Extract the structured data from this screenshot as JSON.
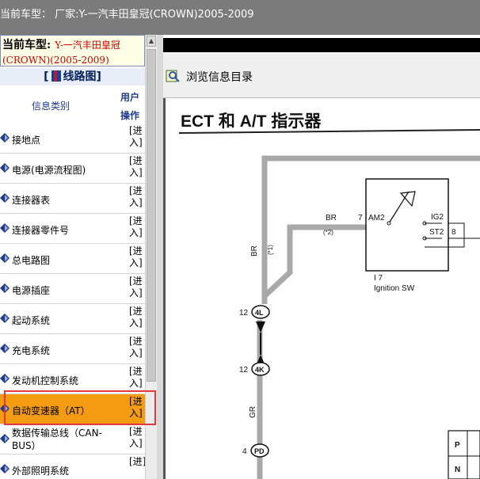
{
  "titlebar": {
    "text": "当前车型：  厂家:Y-一汽丰田皇冠(CROWN)2005-2009"
  },
  "left": {
    "model_label": "当前车型:",
    "model_value": "Y-一汽丰田皇冠(CROWN)(2005-2009)",
    "wiring_title_left": "[",
    "wiring_title": "线路图",
    "wiring_title_right": "]",
    "header": {
      "category": "信息类别",
      "ops_line1": "用户",
      "ops_line2": "操作"
    },
    "items": [
      {
        "label": "接地点",
        "enter": "[进入]"
      },
      {
        "label": "电源(电源流程图)",
        "enter": "[进入]"
      },
      {
        "label": "连接器表",
        "enter": "[进入]"
      },
      {
        "label": "连接器零件号",
        "enter": "[进入]"
      },
      {
        "label": "总电路图",
        "enter": "[进入]"
      },
      {
        "label": "电源插座",
        "enter": "[进入]"
      },
      {
        "label": "起动系统",
        "enter": "[进入]"
      },
      {
        "label": "充电系统",
        "enter": "[进入]"
      },
      {
        "label": "发动机控制系统",
        "enter": "[进入]"
      },
      {
        "label": "自动变速器（AT）",
        "enter": "[进入]"
      },
      {
        "label": "数据传输总线（CAN-BUS）",
        "enter": "[进入]"
      },
      {
        "label": "外部照明系统",
        "enter": "[进]"
      }
    ],
    "selected_index": 9
  },
  "right": {
    "toolbar_label": "浏览信息目录",
    "diagram": {
      "title": "ECT 和 A/T 指示器",
      "wire_br": "BR",
      "wire_br_sub": "(*2)",
      "wire_br_v": "BR",
      "wire_br_v_sub": "(*1)",
      "pin_7": "7",
      "am2": "AM2",
      "ig2": "IG2",
      "st2": "ST2",
      "pin_8": "8",
      "part_id": "I 7",
      "part_name": "Ignition SW",
      "conn_4l_num": "12",
      "conn_4l": "4L",
      "conn_4k_num": "12",
      "conn_4k": "4K",
      "wire_gr": "GR",
      "conn_pd_num": "4",
      "conn_pd": "PD",
      "table_p": "P",
      "table_n": "N"
    }
  },
  "colors": {
    "titlebar_bg": "#7b7b7b",
    "selected_bg": "#f39c12",
    "highlight_border": "#e5383b",
    "header_text": "#1f3b8f",
    "model_value": "#cc0000"
  }
}
